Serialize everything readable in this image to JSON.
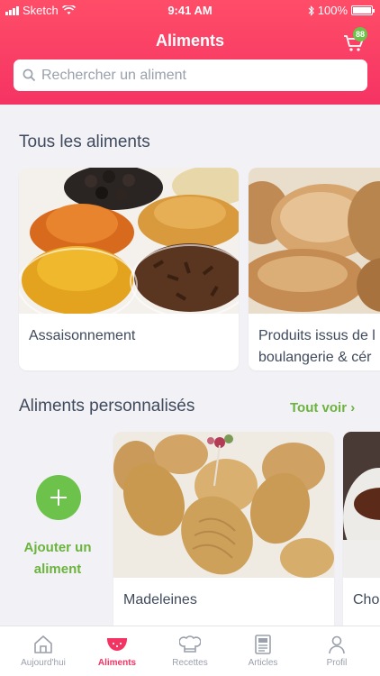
{
  "status": {
    "carrier": "Sketch",
    "time": "9:41 AM",
    "battery": "100%"
  },
  "header": {
    "title": "Aliments",
    "cart_count": "88"
  },
  "search": {
    "placeholder": "Rechercher un aliment"
  },
  "all_foods": {
    "title": "Tous les aliments",
    "cards": [
      {
        "label": "Assaisonnement"
      },
      {
        "label": "Produits issus de l",
        "label2": "boulangerie & cér"
      }
    ]
  },
  "custom_foods": {
    "title": "Aliments personnalisés",
    "see_all": "Tout voir",
    "add_label": "Ajouter un aliment",
    "cards": [
      {
        "label": "Madeleines"
      },
      {
        "label": "Cho"
      }
    ]
  },
  "tabbar": {
    "items": [
      {
        "label": "Aujourd'hui",
        "icon": "home-icon"
      },
      {
        "label": "Aliments",
        "icon": "watermelon-icon",
        "active": true
      },
      {
        "label": "Recettes",
        "icon": "chef-hat-icon"
      },
      {
        "label": "Articles",
        "icon": "article-icon"
      },
      {
        "label": "Profil",
        "icon": "person-icon"
      }
    ]
  },
  "colors": {
    "accent": "#f53363",
    "green": "#6cc24a",
    "text": "#3f4a5c"
  }
}
